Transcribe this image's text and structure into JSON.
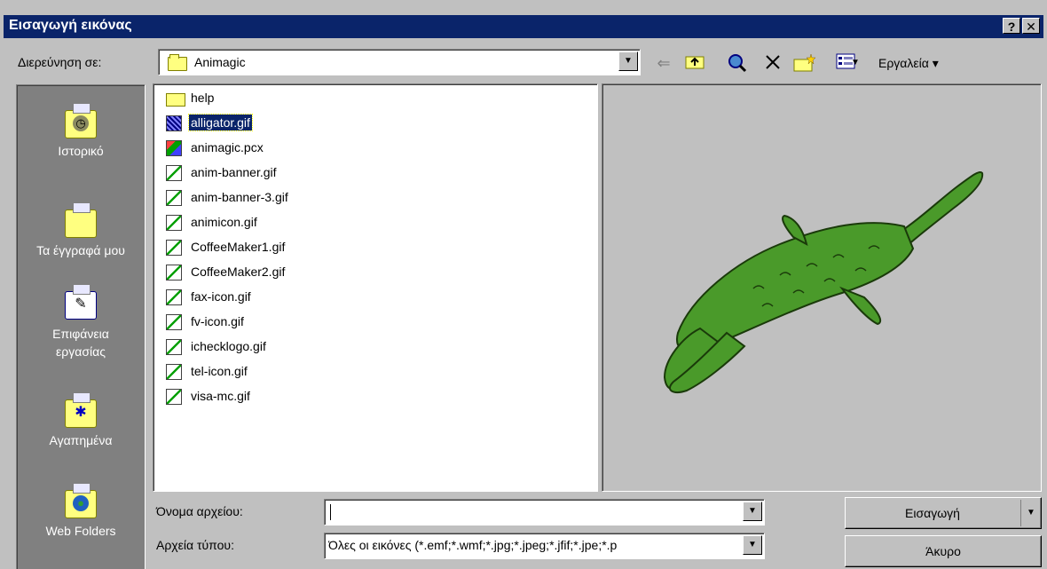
{
  "window": {
    "title": "Εισαγωγή εικόνας",
    "help_glyph": "?",
    "close_glyph": "✕"
  },
  "look_in": {
    "label": "Διερεύνηση σε:",
    "value": "Animagic"
  },
  "toolbar": {
    "back_glyph": "⇐",
    "tools_label": "Εργαλεία ▾"
  },
  "places": [
    {
      "label": "Ιστορικό",
      "icon": "history-icon"
    },
    {
      "label": "Τα έγγραφά μου",
      "icon": "my-documents-icon"
    },
    {
      "label": "Επιφάνεια εργασίας",
      "icon": "desktop-icon"
    },
    {
      "label": "Αγαπημένα",
      "icon": "favorites-icon"
    },
    {
      "label": "Web Folders",
      "icon": "web-folders-icon"
    }
  ],
  "files": [
    {
      "name": "help",
      "type": "folder"
    },
    {
      "name": "alligator.gif",
      "type": "gif",
      "selected": true
    },
    {
      "name": "animagic.pcx",
      "type": "pcx"
    },
    {
      "name": "anim-banner.gif",
      "type": "gif"
    },
    {
      "name": "anim-banner-3.gif",
      "type": "gif"
    },
    {
      "name": "animicon.gif",
      "type": "gif"
    },
    {
      "name": "CoffeeMaker1.gif",
      "type": "gif"
    },
    {
      "name": "CoffeeMaker2.gif",
      "type": "gif"
    },
    {
      "name": "fax-icon.gif",
      "type": "gif"
    },
    {
      "name": "fv-icon.gif",
      "type": "gif"
    },
    {
      "name": "ichecklogo.gif",
      "type": "gif"
    },
    {
      "name": "tel-icon.gif",
      "type": "gif"
    },
    {
      "name": "visa-mc.gif",
      "type": "gif"
    }
  ],
  "filename": {
    "label": "Όνομα αρχείου:",
    "value": ""
  },
  "filetype": {
    "label": "Αρχεία τύπου:",
    "value": "Όλες οι εικόνες (*.emf;*.wmf;*.jpg;*.jpeg;*.jfif;*.jpe;*.p"
  },
  "buttons": {
    "insert": "Εισαγωγή",
    "cancel": "Άκυρο"
  },
  "colors": {
    "title_bar": "#0a246a",
    "places_bar": "#808080",
    "alligator": "#4a9a2a"
  }
}
